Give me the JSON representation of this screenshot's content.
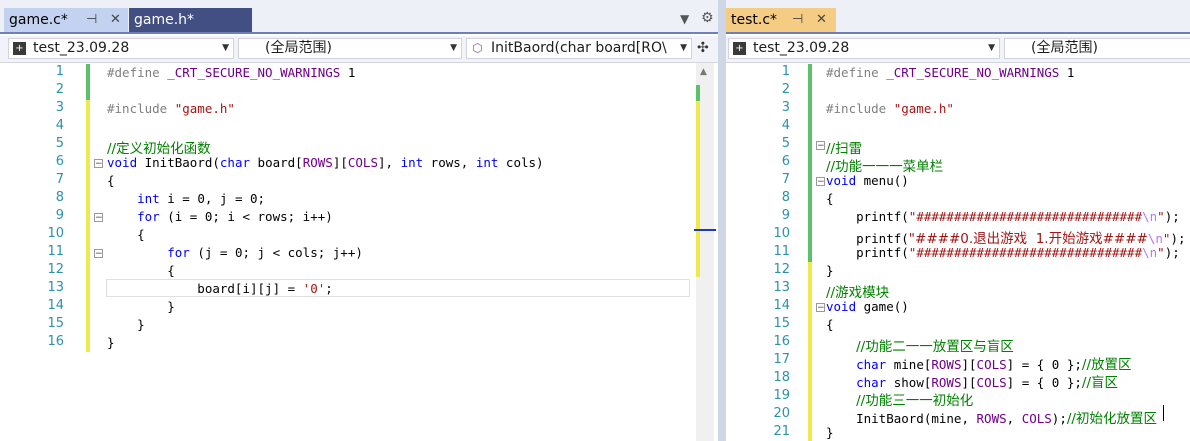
{
  "left": {
    "tabs": [
      {
        "label": "game.c*",
        "state": "active",
        "pinned": true
      },
      {
        "label": "game.h*",
        "state": "inactive"
      }
    ],
    "nav": {
      "project": "test_23.09.28",
      "scope": "(全局范围)",
      "member": "InitBaord(char board[RO\\"
    },
    "lines": [
      {
        "n": "1",
        "change": "green",
        "segs": [
          [
            "#define ",
            "pp"
          ],
          [
            "_CRT_SECURE_NO_WARNINGS",
            "macro"
          ],
          [
            " 1",
            ""
          ]
        ]
      },
      {
        "n": "2",
        "change": "green",
        "segs": []
      },
      {
        "n": "3",
        "change": "yellow",
        "segs": [
          [
            "#include ",
            "pp"
          ],
          [
            "\"game.h\"",
            "str"
          ]
        ]
      },
      {
        "n": "4",
        "change": "yellow",
        "segs": []
      },
      {
        "n": "5",
        "change": "yellow",
        "segs": [
          [
            "//定义初始化函数",
            "cm cjk"
          ]
        ]
      },
      {
        "n": "6",
        "change": "yellow",
        "segs": [
          [
            "void",
            "kw"
          ],
          [
            " InitBaord(",
            ""
          ],
          [
            "char",
            "kw"
          ],
          [
            " board[",
            ""
          ],
          [
            "ROWS",
            "macro"
          ],
          [
            "][",
            ""
          ],
          [
            "COLS",
            "macro"
          ],
          [
            "], ",
            ""
          ],
          [
            "int",
            "kw"
          ],
          [
            " rows, ",
            ""
          ],
          [
            "int",
            "kw"
          ],
          [
            " cols)",
            ""
          ]
        ]
      },
      {
        "n": "7",
        "change": "yellow",
        "segs": [
          [
            "{",
            ""
          ]
        ]
      },
      {
        "n": "8",
        "change": "yellow",
        "segs": [
          [
            "    ",
            ""
          ],
          [
            "int",
            "kw"
          ],
          [
            " i = 0, j = 0;",
            ""
          ]
        ]
      },
      {
        "n": "9",
        "change": "yellow",
        "segs": [
          [
            "    ",
            ""
          ],
          [
            "for",
            "kw"
          ],
          [
            " (i = 0; i < rows; i++)",
            ""
          ]
        ]
      },
      {
        "n": "10",
        "change": "yellow",
        "segs": [
          [
            "    {",
            ""
          ]
        ]
      },
      {
        "n": "11",
        "change": "yellow",
        "segs": [
          [
            "        ",
            ""
          ],
          [
            "for",
            "kw"
          ],
          [
            " (j = 0; j < cols; j++)",
            ""
          ]
        ]
      },
      {
        "n": "12",
        "change": "yellow",
        "segs": [
          [
            "        {",
            ""
          ]
        ]
      },
      {
        "n": "13",
        "change": "yellow",
        "segs": [
          [
            "            board[i][j] = ",
            ""
          ],
          [
            "'0'",
            "str"
          ],
          [
            ";",
            ""
          ]
        ]
      },
      {
        "n": "14",
        "change": "yellow",
        "segs": [
          [
            "        }",
            ""
          ]
        ]
      },
      {
        "n": "15",
        "change": "yellow",
        "segs": [
          [
            "    }",
            ""
          ]
        ]
      },
      {
        "n": "16",
        "change": "yellow",
        "segs": [
          [
            "}",
            ""
          ]
        ]
      }
    ]
  },
  "right": {
    "tabs": [
      {
        "label": "test.c*",
        "state": "active",
        "pinned": true
      }
    ],
    "nav": {
      "project": "test_23.09.28",
      "scope": "(全局范围)"
    },
    "lines": [
      {
        "n": "1",
        "change": "green",
        "segs": [
          [
            "#define ",
            "pp"
          ],
          [
            "_CRT_SECURE_NO_WARNINGS",
            "macro"
          ],
          [
            " 1",
            ""
          ]
        ]
      },
      {
        "n": "2",
        "change": "green",
        "segs": []
      },
      {
        "n": "3",
        "change": "green",
        "segs": [
          [
            "#include ",
            "pp"
          ],
          [
            "\"game.h\"",
            "str"
          ]
        ]
      },
      {
        "n": "4",
        "change": "green",
        "segs": []
      },
      {
        "n": "5",
        "change": "green",
        "segs": [
          [
            "//扫雷",
            "cm cjk"
          ]
        ]
      },
      {
        "n": "6",
        "change": "green",
        "segs": [
          [
            "//功能一一一菜单栏",
            "cm cjk"
          ]
        ]
      },
      {
        "n": "7",
        "change": "green",
        "segs": [
          [
            "void",
            "kw"
          ],
          [
            " menu()",
            ""
          ]
        ]
      },
      {
        "n": "8",
        "change": "green",
        "segs": [
          [
            "{",
            ""
          ]
        ]
      },
      {
        "n": "9",
        "change": "green",
        "segs": [
          [
            "    printf(",
            ""
          ],
          [
            "\"##############################",
            "str"
          ],
          [
            "\\n",
            "esc"
          ],
          [
            "\"",
            "str"
          ],
          [
            ");",
            ""
          ]
        ]
      },
      {
        "n": "10",
        "change": "green",
        "segs": [
          [
            "    printf(",
            ""
          ],
          [
            "\"####0.退出游戏  1.开始游戏####",
            "str cjk"
          ],
          [
            "\\n",
            "esc"
          ],
          [
            "\"",
            "str"
          ],
          [
            ");",
            ""
          ]
        ]
      },
      {
        "n": "11",
        "change": "green",
        "segs": [
          [
            "    printf(",
            ""
          ],
          [
            "\"##############################",
            "str"
          ],
          [
            "\\n",
            "esc"
          ],
          [
            "\"",
            "str"
          ],
          [
            ");",
            ""
          ]
        ]
      },
      {
        "n": "12",
        "change": "yellow",
        "segs": [
          [
            "}",
            ""
          ]
        ]
      },
      {
        "n": "13",
        "change": "yellow",
        "segs": [
          [
            "//游戏模块",
            "cm cjk"
          ]
        ]
      },
      {
        "n": "14",
        "change": "yellow",
        "segs": [
          [
            "void",
            "kw"
          ],
          [
            " game()",
            ""
          ]
        ]
      },
      {
        "n": "15",
        "change": "yellow",
        "segs": [
          [
            "{",
            ""
          ]
        ]
      },
      {
        "n": "16",
        "change": "yellow",
        "segs": [
          [
            "    ",
            ""
          ],
          [
            "//功能二一一放置区与盲区",
            "cm cjk"
          ]
        ]
      },
      {
        "n": "17",
        "change": "yellow",
        "segs": [
          [
            "    ",
            ""
          ],
          [
            "char",
            "kw"
          ],
          [
            " mine[",
            ""
          ],
          [
            "ROWS",
            "macro"
          ],
          [
            "][",
            ""
          ],
          [
            "COLS",
            "macro"
          ],
          [
            "] = { 0 };",
            ""
          ],
          [
            "//放置区",
            "cm cjk"
          ]
        ]
      },
      {
        "n": "18",
        "change": "yellow",
        "segs": [
          [
            "    ",
            ""
          ],
          [
            "char",
            "kw"
          ],
          [
            " show[",
            ""
          ],
          [
            "ROWS",
            "macro"
          ],
          [
            "][",
            ""
          ],
          [
            "COLS",
            "macro"
          ],
          [
            "] = { 0 };",
            ""
          ],
          [
            "//盲区",
            "cm cjk"
          ]
        ]
      },
      {
        "n": "19",
        "change": "yellow",
        "segs": [
          [
            "    ",
            ""
          ],
          [
            "//功能三一一初始化",
            "cm cjk"
          ]
        ]
      },
      {
        "n": "20",
        "change": "yellow",
        "segs": [
          [
            "    InitBaord(mine, ",
            ""
          ],
          [
            "ROWS",
            "macro"
          ],
          [
            ", ",
            ""
          ],
          [
            "COLS",
            "macro"
          ],
          [
            ");",
            ""
          ],
          [
            "//初始化放置区",
            "cm cjk"
          ]
        ]
      },
      {
        "n": "21",
        "change": "yellow",
        "segs": [
          [
            "}",
            ""
          ]
        ]
      }
    ]
  },
  "colors": {
    "green": "#5cc16b",
    "yellow": "#f0e94e",
    "accent": "#424f82",
    "caret_marker": "#1f3bb3"
  }
}
